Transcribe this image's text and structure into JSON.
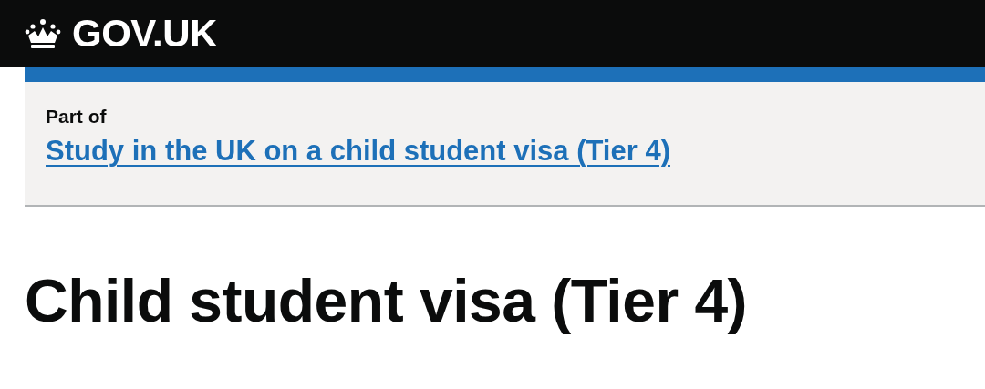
{
  "header": {
    "logo": "GOV.UK"
  },
  "breadcrumb": {
    "label": "Part of",
    "link": "Study in the UK on a child student visa (Tier 4)"
  },
  "heading": "Child student visa (Tier 4)"
}
